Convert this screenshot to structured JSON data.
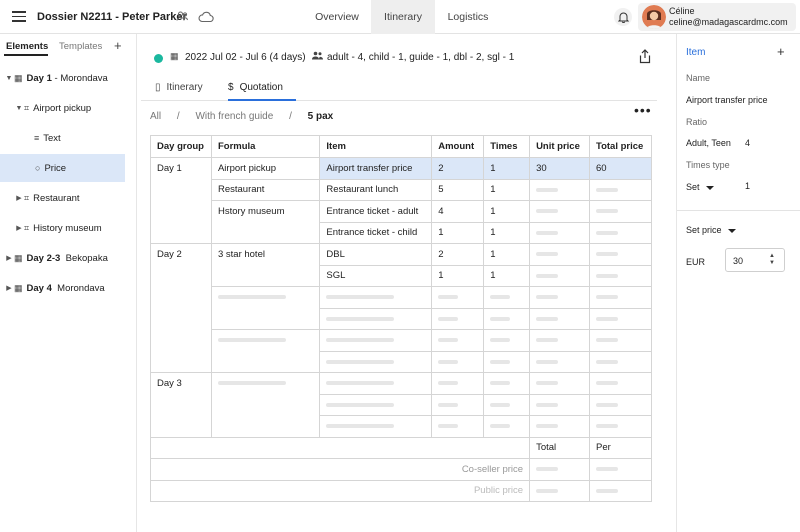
{
  "header": {
    "title": "Dossier N2211 - Peter Parker",
    "tabs": [
      {
        "label": "Overview",
        "active": false
      },
      {
        "label": "Itinerary",
        "active": true
      },
      {
        "label": "Logistics",
        "active": false
      }
    ],
    "user": {
      "name": "Céline",
      "email": "celine@madagascardmc.com"
    }
  },
  "left_panel": {
    "tabs": [
      "Elements",
      "Templates"
    ],
    "add_label": "+",
    "tree": [
      {
        "day": "Day 1",
        "place": " - Morondava"
      },
      {
        "label": "Airport pickup"
      },
      {
        "label": "Text"
      },
      {
        "label": "Price",
        "selected": true
      },
      {
        "label": "Restaurant"
      },
      {
        "label": "History museum"
      },
      {
        "day": "Day 2-3",
        "place": "  Bekopaka"
      },
      {
        "day": "Day 4",
        "place": "  Morondava"
      }
    ]
  },
  "main": {
    "date_range": "2022 Jul 02 - Jul 6 (4 days)",
    "pax_summary": "adult - 4, child - 1, guide - 1, dbl - 2, sgl - 1",
    "subtabs": [
      "Itinerary",
      "Quotation"
    ],
    "breadcrumb": [
      "All",
      "With french guide",
      "5 pax"
    ],
    "breadcrumb_sep": "/",
    "more_label": "•••",
    "table": {
      "headers": [
        "Day group",
        "Formula",
        "Item",
        "Amount",
        "Times",
        "Unit price",
        "Total price"
      ],
      "groups": [
        {
          "day": "Day 1",
          "formulas": [
            "Airport pickup",
            "Restaurant",
            "Hstory museum",
            ""
          ]
        },
        {
          "day": "Day 2",
          "formulas": [
            "3 star hotel",
            "",
            "",
            ""
          ]
        },
        {
          "day": "Day 3"
        }
      ],
      "rows": [
        {
          "item": "Airport transfer price",
          "amount": "2",
          "times": "1",
          "unit": "30",
          "total": "60"
        },
        {
          "item": "Restaurant lunch",
          "amount": "5",
          "times": "1"
        },
        {
          "item": "Entrance ticket - adult",
          "amount": "4",
          "times": "1"
        },
        {
          "item": "Entrance ticket - child",
          "amount": "1",
          "times": "1"
        },
        {
          "item": "DBL",
          "amount": "2",
          "times": "1"
        },
        {
          "item": "SGL",
          "amount": "1",
          "times": "1"
        }
      ],
      "footer": {
        "total": "Total",
        "per": "Per",
        "coseller": "Co-seller price",
        "public": "Public price"
      }
    }
  },
  "right_panel": {
    "title": "Item",
    "add_label": "+",
    "name_label": "Name",
    "name_value": "Airport transfer price",
    "ratio_label": "Ratio",
    "ratio_key": "Adult, Teen",
    "ratio_value": "4",
    "times_type_label": "Times type",
    "times_type_value": "Set",
    "times_value": "1",
    "set_price_label": "Set price",
    "currency": "EUR",
    "price_value": "30"
  },
  "colors": {
    "accent": "#2a6fdb",
    "status_dot": "#1bb89f",
    "selection": "#dbe7f8"
  },
  "icons": [
    "menu-icon",
    "people-icon",
    "cloud-icon",
    "bell-icon",
    "calendar-icon",
    "share-icon",
    "map-icon",
    "dollar-icon",
    "group-icon",
    "text-icon",
    "circle-icon"
  ]
}
